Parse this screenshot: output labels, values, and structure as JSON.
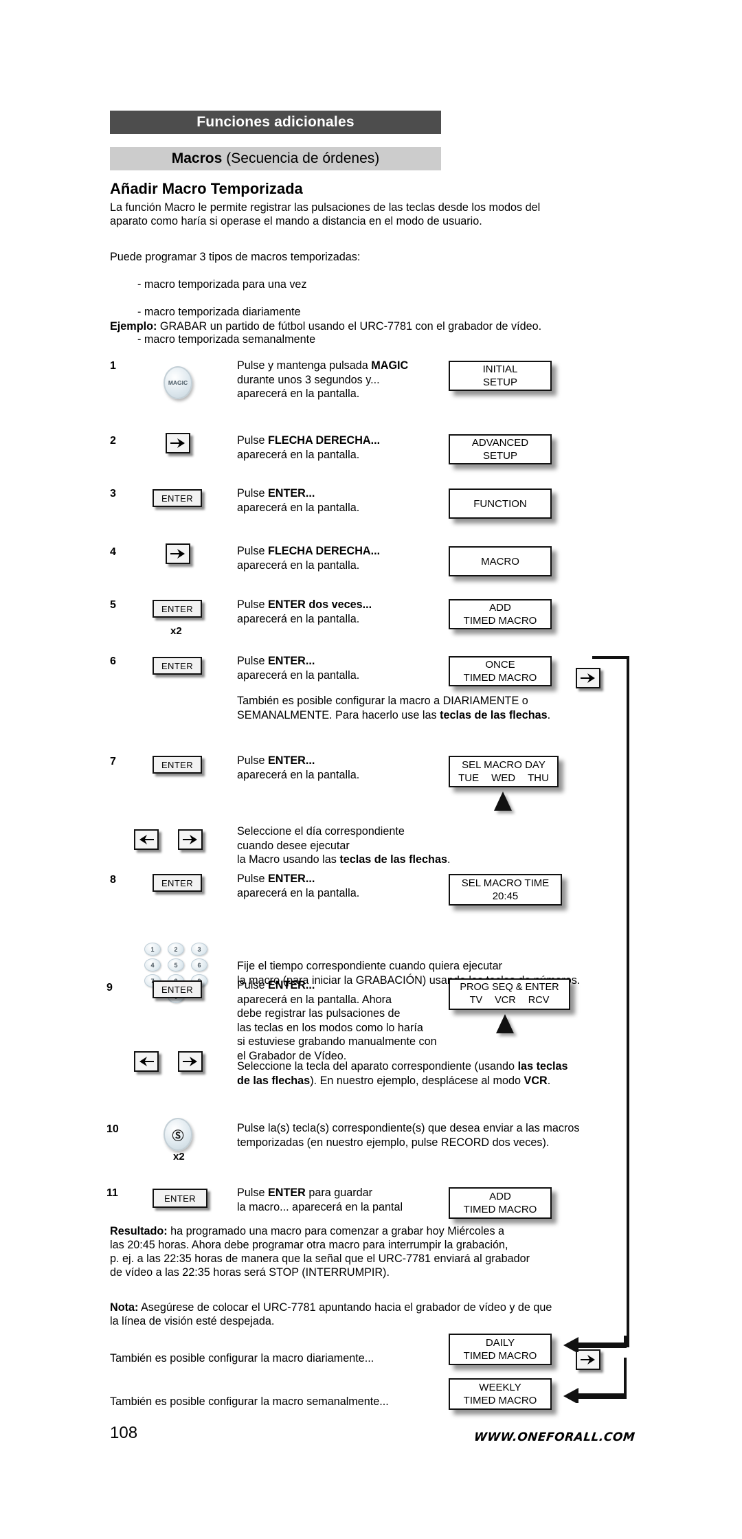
{
  "header": {
    "section_title": "Funciones adicionales",
    "topic_bold": "Macros",
    "topic_rest": "(Secuencia de órdenes)"
  },
  "content": {
    "heading": "Añadir Macro Temporizada",
    "intro": "La función Macro le permite registrar las pulsaciones de las teclas desde los modos del\naparato como haría si operase el mando a distancia en el modo de usuario.",
    "types_lead": "Puede programar 3 tipos de macros temporizadas:",
    "types": [
      "- macro temporizada para una vez",
      "- macro temporizada diariamente",
      "- macro temporizada semanalmente"
    ],
    "example_label": "Ejemplo:",
    "example_text": " GRABAR un partido de fútbol usando el URC-7781 con el grabador de vídeo."
  },
  "steps": [
    {
      "num": "1",
      "key": "MAGIC",
      "instruction_bold_pre": "Pulse y mantenga pulsada ",
      "instruction_bold": "MAGIC",
      "instruction_rest": "\ndurante unos 3 segundos y...\naparecerá en la pantalla.",
      "lcd_line1": "INITIAL",
      "lcd_line2": "SETUP"
    },
    {
      "num": "2",
      "key": "right-arrow",
      "instruction_bold_pre": "Pulse ",
      "instruction_bold": "FLECHA DERECHA...",
      "instruction_rest": "\naparecerá en la pantalla.",
      "lcd_line1": "ADVANCED",
      "lcd_line2": "SETUP"
    },
    {
      "num": "3",
      "key": "ENTER",
      "instruction_bold_pre": "Pulse ",
      "instruction_bold": "ENTER...",
      "instruction_rest": "\naparecerá en la pantalla.",
      "lcd_line1": "FUNCTION",
      "lcd_line2": ""
    },
    {
      "num": "4",
      "key": "right-arrow",
      "instruction_bold_pre": "Pulse ",
      "instruction_bold": "FLECHA DERECHA...",
      "instruction_rest": "\naparecerá en la pantalla.",
      "lcd_line1": "MACRO",
      "lcd_line2": ""
    },
    {
      "num": "5",
      "key": "ENTER",
      "key_multiplier": "x2",
      "instruction_bold_pre": "Pulse ",
      "instruction_bold": "ENTER dos veces...",
      "instruction_rest": "\naparecerá en la pantalla.",
      "lcd_line1": "ADD",
      "lcd_line2": "TIMED MACRO"
    },
    {
      "num": "6",
      "key": "ENTER",
      "instruction_bold_pre": "Pulse ",
      "instruction_bold": "ENTER...",
      "instruction_rest": "\naparecerá en la pantalla.",
      "lcd_line1": "ONCE",
      "lcd_line2": "TIMED MACRO",
      "note_pre": "También es posible configurar la macro a DIARIAMENTE o\nSEMANALMENTE. Para hacerlo use las ",
      "note_bold": "teclas de las flechas",
      "note_post": "."
    },
    {
      "num": "7",
      "key": "ENTER",
      "instruction_bold_pre": "Pulse ",
      "instruction_bold": "ENTER...",
      "instruction_rest": "\naparecerá en la pantalla.",
      "lcd_line1": "SEL MACRO DAY",
      "lcd_row2": [
        "TUE",
        "WED",
        "THU"
      ],
      "note_pre": "Seleccione el día correspondiente\ncuando desee ejecutar\nla Macro usando las ",
      "note_bold": "teclas de las flechas",
      "note_post": "."
    },
    {
      "num": "8",
      "key": "ENTER",
      "instruction_bold_pre": "Pulse ",
      "instruction_bold": "ENTER...",
      "instruction_rest": "\naparecerá en la pantalla.",
      "lcd_line1": "SEL MACRO TIME",
      "lcd_line2": "20:45",
      "note_pre": "Fije el tiempo correspondiente cuando quiera ejecutar\nla macro (para iniciar la GRABACIÓN) usando las teclas de números.",
      "keypad": [
        "1",
        "2",
        "3",
        "4",
        "5",
        "6",
        "7",
        "8",
        "9",
        "0"
      ]
    },
    {
      "num": "9",
      "key": "ENTER",
      "instruction_bold_pre": "Pulse ",
      "instruction_bold": "ENTER...",
      "instruction_rest": "\naparecerá en la pantalla. Ahora\ndebe registrar las pulsaciones de\nlas teclas en los modos como lo haría\nsi estuviese grabando manualmente con el Grabador de Vídeo.",
      "lcd_line1": "PROG SEQ & ENTER",
      "lcd_row2": [
        "TV",
        "VCR",
        "RCV"
      ],
      "note_pre": "Seleccione la tecla del aparato correspondiente (usando ",
      "note_bold": "las teclas\nde las flechas",
      "note_mid": "). En nuestro ejemplo, desplácese al modo ",
      "note_bold2": "VCR",
      "note_post": "."
    },
    {
      "num": "10",
      "key": "RECORD",
      "key_multiplier": "x2",
      "instruction_plain": "Pulse la(s) tecla(s) correspondiente(s) que desea enviar a las macros\ntemporizadas (en nuestro ejemplo, pulse RECORD dos veces)."
    },
    {
      "num": "11",
      "key": "ENTER",
      "instruction_bold_pre": "Pulse ",
      "instruction_bold": "ENTER",
      "instruction_rest": " para guardar\nla macro... aparecerá en la pantal",
      "lcd_line1": "ADD",
      "lcd_line2": "TIMED MACRO"
    }
  ],
  "result": {
    "label": "Resultado:",
    "text": " ha programado una macro para comenzar a grabar hoy Miércoles a\nlas 20:45 horas. Ahora debe programar otra macro para interrumpir la grabación,\np. ej. a las 22:35 horas de manera que la señal que el URC-7781 enviará al grabador\nde vídeo a las 22:35 horas será STOP (INTERRUMPIR)."
  },
  "note": {
    "label": "Nota:",
    "text": " Asegúrese de colocar el URC-7781 apuntando hacia el grabador de vídeo y de que\n        la línea de visión esté despejada."
  },
  "alternatives": [
    {
      "text": "También es posible configurar la macro diariamente...",
      "lcd_line1": "DAILY",
      "lcd_line2": "TIMED MACRO"
    },
    {
      "text": "También es posible configurar la macro semanalmente...",
      "lcd_line1": "WEEKLY",
      "lcd_line2": "TIMED MACRO"
    }
  ],
  "footer": {
    "page_number": "108",
    "url": "WWW.ONEFORALL.COM"
  },
  "colors": {
    "bar_dark": "#4d4d4d",
    "bar_light": "#cccccc",
    "text": "#000000"
  }
}
